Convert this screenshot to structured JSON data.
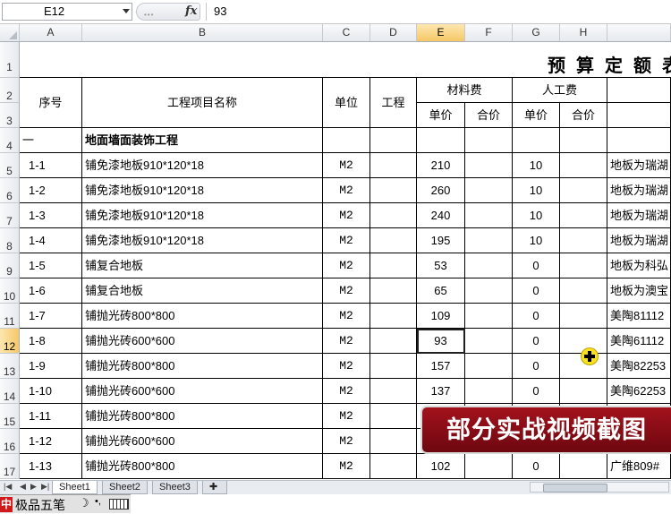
{
  "formula_bar": {
    "name_box": "E12",
    "fx": "fx",
    "value": "93"
  },
  "columns": [
    {
      "key": "A",
      "w": 70
    },
    {
      "key": "B",
      "w": 269
    },
    {
      "key": "C",
      "w": 53
    },
    {
      "key": "D",
      "w": 52
    },
    {
      "key": "E",
      "w": 54
    },
    {
      "key": "F",
      "w": 53
    },
    {
      "key": "G",
      "w": 53
    },
    {
      "key": "H",
      "w": 53
    },
    {
      "key": "I",
      "w": 71
    }
  ],
  "selected_column": "E",
  "selected_row": "12",
  "rows": [
    "1",
    "2",
    "3",
    "4",
    "5",
    "6",
    "7",
    "8",
    "9",
    "10",
    "11",
    "12",
    "13",
    "14",
    "15",
    "16",
    "17"
  ],
  "title": "预算定额表",
  "header": {
    "seq": "序号",
    "name": "工程项目名称",
    "unit": "单位",
    "qty": "工程",
    "material": "材料费",
    "labor": "人工费",
    "unit_price": "单价",
    "total_price": "合价"
  },
  "section": {
    "seq": "一",
    "name": "地面墙面装饰工程"
  },
  "items": [
    {
      "seq": "1-1",
      "name": "铺免漆地板910*120*18",
      "unit": "M2",
      "mat": "210",
      "lab": "10",
      "note": "地板为瑞湖"
    },
    {
      "seq": "1-2",
      "name": "铺免漆地板910*120*18",
      "unit": "M2",
      "mat": "260",
      "lab": "10",
      "note": "地板为瑞湖"
    },
    {
      "seq": "1-3",
      "name": "铺免漆地板910*120*18",
      "unit": "M2",
      "mat": "240",
      "lab": "10",
      "note": "地板为瑞湖"
    },
    {
      "seq": "1-4",
      "name": "铺免漆地板910*120*18",
      "unit": "M2",
      "mat": "195",
      "lab": "10",
      "note": "地板为瑞湖"
    },
    {
      "seq": "1-5",
      "name": "铺复合地板",
      "unit": "M2",
      "mat": "53",
      "lab": "0",
      "note": "地板为科弘"
    },
    {
      "seq": "1-6",
      "name": "铺复合地板",
      "unit": "M2",
      "mat": "65",
      "lab": "0",
      "note": "地板为澳宝"
    },
    {
      "seq": "1-7",
      "name": "铺抛光砖800*800",
      "unit": "M2",
      "mat": "109",
      "lab": "0",
      "note": "美陶81112"
    },
    {
      "seq": "1-8",
      "name": "铺抛光砖600*600",
      "unit": "M2",
      "mat": "93",
      "lab": "0",
      "note": "美陶61112"
    },
    {
      "seq": "1-9",
      "name": "铺抛光砖800*800",
      "unit": "M2",
      "mat": "157",
      "lab": "0",
      "note": "美陶82253"
    },
    {
      "seq": "1-10",
      "name": "铺抛光砖600*600",
      "unit": "M2",
      "mat": "137",
      "lab": "0",
      "note": "美陶62253"
    },
    {
      "seq": "1-11",
      "name": "铺抛光砖800*800",
      "unit": "M2",
      "mat": "",
      "lab": "",
      "note": ""
    },
    {
      "seq": "1-12",
      "name": "铺抛光砖600*600",
      "unit": "M2",
      "mat": "",
      "lab": "",
      "note": ""
    },
    {
      "seq": "1-13",
      "name": "铺抛光砖800*800",
      "unit": "M2",
      "mat": "102",
      "lab": "0",
      "note": "广维809#"
    }
  ],
  "sheet_tabs": [
    "Sheet1",
    "Sheet2",
    "Sheet3"
  ],
  "ime": {
    "logo": "中",
    "name": "极品五笔",
    "moon": "☽",
    "punct": "•,"
  },
  "banner": "部分实战视频截图",
  "colors": {
    "header_sel": "#f6c866",
    "banner": "#8a0c15"
  }
}
